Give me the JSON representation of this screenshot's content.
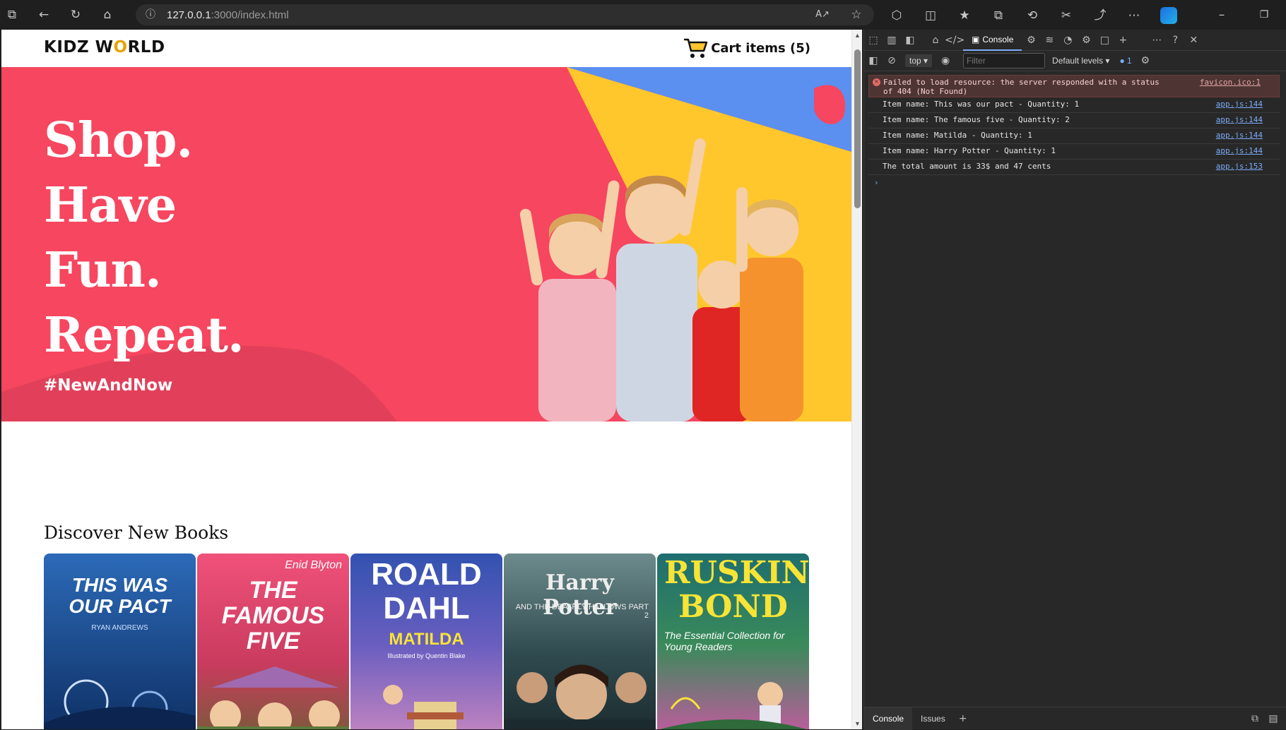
{
  "browser": {
    "url_host": "127.0.0.1",
    "url_rest": ":3000/index.html"
  },
  "site": {
    "logo_part1": "KIDZ W",
    "logo_o": "O",
    "logo_part2": "RLD",
    "cart_label": "Cart items (5)"
  },
  "hero": {
    "lines": [
      "Shop.",
      "Have",
      "Fun.",
      "Repeat."
    ],
    "hashtag": "#NewAndNow",
    "colors": {
      "background": "#f7465f",
      "yellow": "#ffc72c",
      "blue": "#5b8ff0"
    }
  },
  "books_section": {
    "title": "Discover New Books",
    "books": [
      {
        "title": "THIS WAS OUR PACT",
        "author": "RYAN ANDREWS",
        "bg": "#1f4f95",
        "fg": "#ffffff"
      },
      {
        "title": "THE FAMOUS FIVE",
        "author": "Enid Blyton",
        "bg": "#e8446a",
        "fg": "#ffffff"
      },
      {
        "title": "ROALD DAHL",
        "author": "MATILDA",
        "bg": "#3a57b5",
        "fg": "#ffffff",
        "sub2": "Illustrated by Quentin Blake"
      },
      {
        "title": "Harry Potter",
        "author": "AND THE DEATHLY HALLOWS PART 2",
        "bg": "#2e4a52",
        "fg": "#e8e8e8"
      },
      {
        "title": "RUSKIN BOND",
        "author": "The Essential Collection for Young Readers",
        "bg": "#1f7a6e",
        "fg": "#f7e436"
      }
    ]
  },
  "devtools": {
    "console_tab": "Console",
    "context": "top",
    "filter_placeholder": "Filter",
    "levels": "Default levels",
    "issue_count": "1",
    "error": {
      "text": "Failed to load resource: the server responded with a status of 404 (Not Found)",
      "source": "favicon.ico:1"
    },
    "logs": [
      {
        "text": "Item name: This was our pact - Quantity: 1",
        "source": "app.js:144"
      },
      {
        "text": "Item name: The famous five - Quantity: 2",
        "source": "app.js:144"
      },
      {
        "text": "Item name: Matilda - Quantity: 1",
        "source": "app.js:144"
      },
      {
        "text": "Item name: Harry Potter - Quantity: 1",
        "source": "app.js:144"
      },
      {
        "text": "The total amount is 33$ and 47 cents",
        "source": "app.js:153"
      }
    ],
    "bottom_tabs": [
      "Console",
      "Issues"
    ]
  }
}
